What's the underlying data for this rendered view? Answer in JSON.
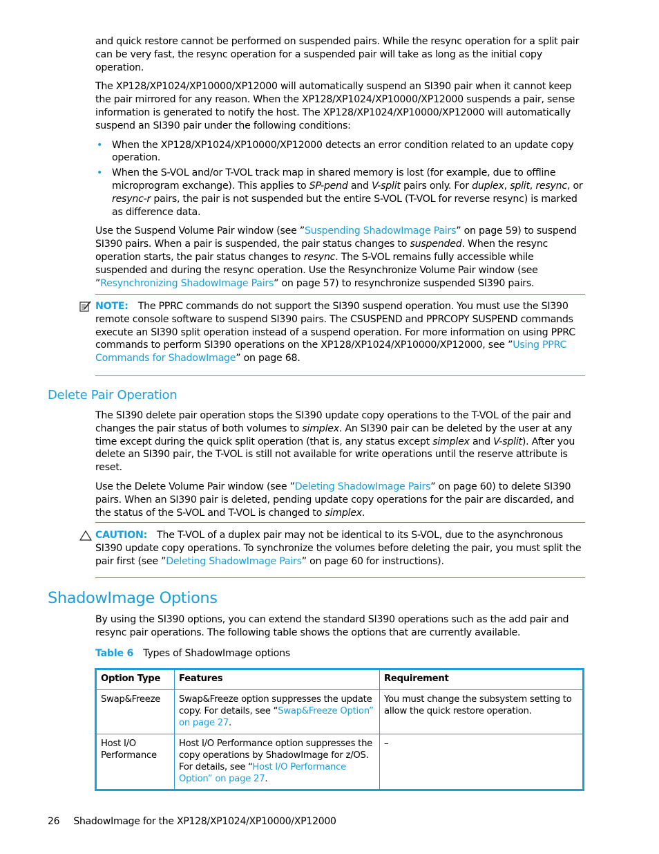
{
  "paragraphs_top": [
    {
      "segments": [
        {
          "t": "and quick restore cannot be performed on suspended pairs. While the resync operation for a split pair can be very fast, the resync operation for a suspended pair will take as long as the initial copy operation."
        }
      ]
    },
    {
      "segments": [
        {
          "t": "The XP128/XP1024/XP10000/XP12000 will automatically suspend an SI390 pair when it cannot keep the pair mirrored for any reason. When the XP128/XP1024/XP10000/XP12000 suspends a pair, sense information is generated to notify the host. The XP128/XP1024/XP10000/XP12000 will automatically suspend an SI390 pair under the following conditions:"
        }
      ]
    }
  ],
  "bullets": [
    {
      "text": "When the XP128/XP1024/XP10000/XP12000 detects an error condition related to an update copy operation."
    },
    {
      "parts": [
        "When the S-VOL and/or T-VOL track map in shared memory is lost (for example, due to offline microprogram exchange). This applies to ",
        "SP-pend",
        " and ",
        "V-split",
        " pairs only. For ",
        "duplex",
        ", ",
        "split",
        ", ",
        "resync",
        ", or ",
        "resync-r",
        " pairs, the pair is not suspended but the entire S-VOL (T-VOL for reverse resync) is marked as difference data."
      ]
    }
  ],
  "suspend_para": {
    "p1": "Use the Suspend Volume Pair window (see ”",
    "link1": "Suspending ShadowImage Pairs",
    "p2": "” on page 59) to suspend SI390 pairs. When a pair is suspended, the pair status changes to ",
    "em1": "suspended",
    "p3": ". When the resync operation starts, the pair status changes to ",
    "em2": "resync",
    "p4": ". The S-VOL remains fully accessible while suspended and during the resync operation. Use the Resynchronize Volume Pair window (see ”",
    "link2": "Resynchronizing ShadowImage Pairs",
    "p5": "” on page 57) to resynchronize suspended SI390 pairs."
  },
  "note": {
    "icon": "note-icon",
    "label": "NOTE:",
    "p1": "The PPRC commands do not support the SI390 suspend operation. You must use the SI390 remote console software to suspend SI390 pairs. The CSUSPEND and PPRCOPY SUSPEND commands execute an SI390 split operation instead of a suspend operation. For more information on using PPRC commands to perform SI390 operations on the XP128/XP1024/XP10000/XP12000, see ”",
    "link": "Using PPRC Commands for ShadowImage",
    "p2": "” on page 68."
  },
  "delete_heading": "Delete Pair Operation",
  "delete_para1": {
    "p1": "The SI390 delete pair operation stops the SI390 update copy operations to the T-VOL of the pair and changes the pair status of both volumes to ",
    "em1": "simplex",
    "p2": ". An SI390 pair can be deleted by the user at any time except during the quick split operation (that is, any status except ",
    "em2": "simplex",
    "p3": " and ",
    "em3": "V-split",
    "p4": "). After you delete an SI390 pair, the T-VOL is still not available for write operations until the reserve attribute is reset."
  },
  "delete_para2": {
    "p1": "Use the Delete Volume Pair window (see ”",
    "link": "Deleting ShadowImage Pairs",
    "p2": "” on page 60) to delete SI390 pairs. When an SI390 pair is deleted, pending update copy operations for the pair are discarded, and the status of the S-VOL and T-VOL is changed to ",
    "em": "simplex",
    "p3": "."
  },
  "caution": {
    "icon": "caution-triangle-icon",
    "label": "CAUTION:",
    "p1": "The T-VOL of a duplex pair may not be identical to its S-VOL, due to the asynchronous SI390 update copy operations. To synchronize the volumes before deleting the pair, you must split the pair first (see ”",
    "link": "Deleting ShadowImage Pairs",
    "p2": "” on page 60 for instructions)."
  },
  "options_heading": "ShadowImage Options",
  "options_para": "By using the SI390 options, you can extend the standard SI390 operations such as the add pair and resync pair operations. The following table shows the options that are currently available.",
  "table": {
    "caption_num": "Table 6",
    "caption_text": "Types of ShadowImage options",
    "headers": [
      "Option Type",
      "Features",
      "Requirement"
    ],
    "rows": [
      {
        "option": "Swap&Freeze",
        "features_text": "Swap&Freeze option suppresses the update copy. For details, see “",
        "features_link": "Swap&Freeze Option” on page 27",
        "features_end": ".",
        "requirement": "You must change the subsystem setting to allow the quick restore operation."
      },
      {
        "option": "Host I/O Performance",
        "features_text": "Host I/O Performance option suppresses the copy operations by ShadowImage for z/OS. For details, see “",
        "features_link": "Host I/O Performance Option” on page 27",
        "features_end": ".",
        "requirement": "–"
      }
    ]
  },
  "footer": {
    "page_number": "26",
    "title": "ShadowImage for the XP128/XP1024/XP10000/XP12000"
  },
  "colors": {
    "accent": "#1a9fd8",
    "text": "#000000"
  }
}
